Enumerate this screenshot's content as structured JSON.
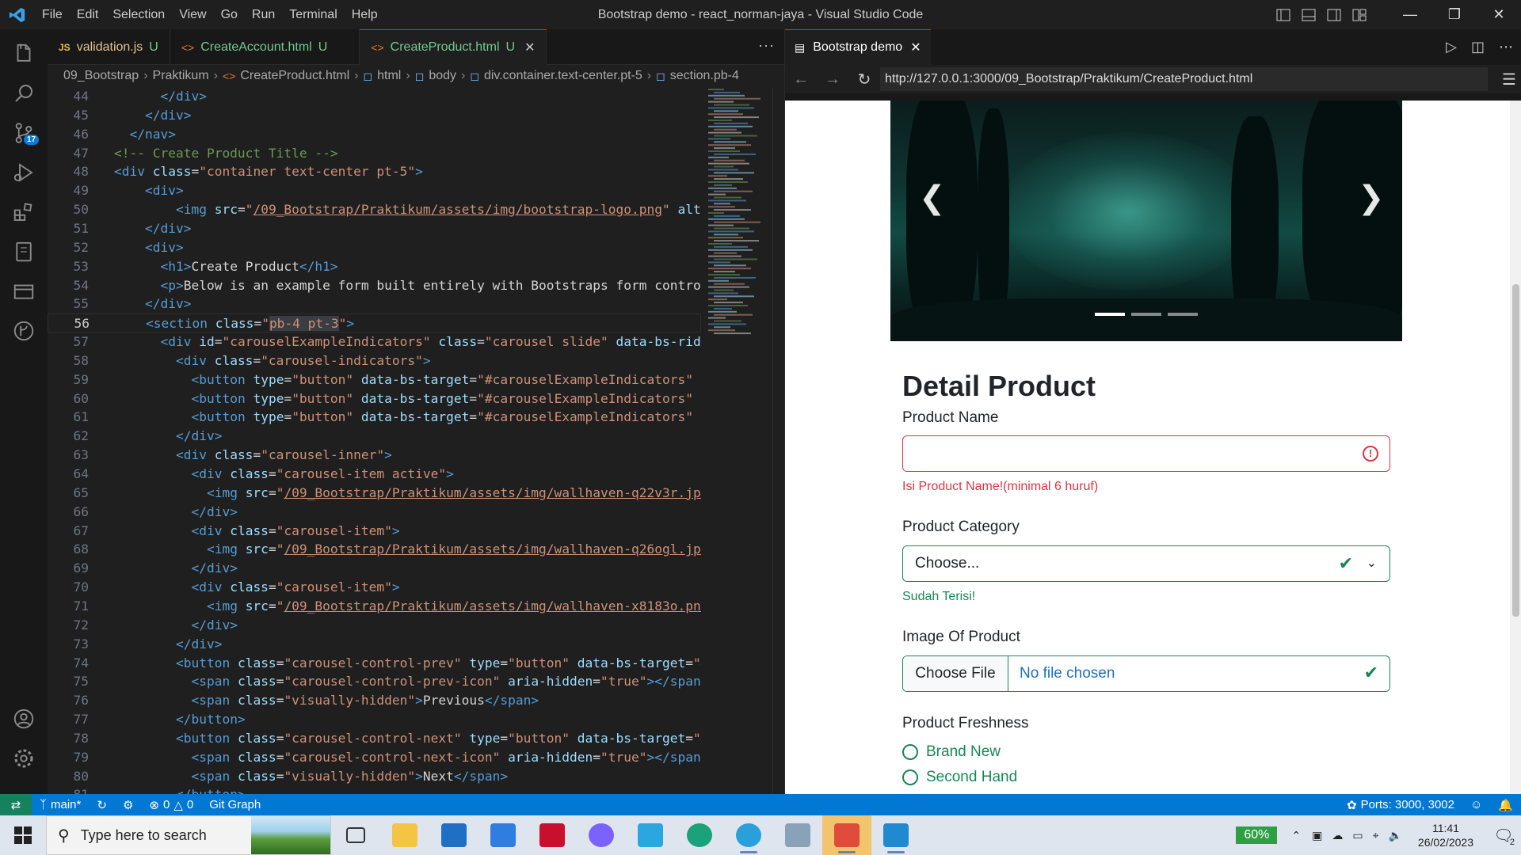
{
  "titlebar": {
    "menu": [
      "File",
      "Edit",
      "Selection",
      "View",
      "Go",
      "Run",
      "Terminal",
      "Help"
    ],
    "title": "Bootstrap demo - react_norman-jaya - Visual Studio Code"
  },
  "activity": {
    "source_control_badge": "17"
  },
  "editor": {
    "tabs": [
      {
        "icon": "JS",
        "label": "validation.js",
        "status": "U"
      },
      {
        "icon": "<>",
        "label": "CreateAccount.html",
        "status": "U"
      },
      {
        "icon": "<>",
        "label": "CreateProduct.html",
        "status": "U",
        "active": true
      }
    ],
    "more": "···",
    "breadcrumb": [
      "09_Bootstrap",
      "Praktikum",
      "CreateProduct.html",
      "html",
      "body",
      "div.container.text-center.pt-5",
      "section.pb-4"
    ]
  },
  "code": [
    {
      "n": "44",
      "html": "      &lt;/div&gt;"
    },
    {
      "n": "45",
      "html": "    &lt;/div&gt;"
    },
    {
      "n": "46",
      "html": "  &lt;/nav&gt;"
    }
  ],
  "preview": {
    "tab_label": "Bootstrap demo",
    "url": "http://127.0.0.1:3000/09_Bootstrap/Praktikum/CreateProduct.html",
    "page": {
      "heading": "Detail Product",
      "product_name_label": "Product Name",
      "product_name_value": "",
      "product_name_feedback": "Isi Product Name!(minimal 6 huruf)",
      "category_label": "Product Category",
      "category_value": "Choose...",
      "category_feedback": "Sudah Terisi!",
      "image_label": "Image Of Product",
      "choose_file": "Choose File",
      "no_file": "No file chosen",
      "freshness_label": "Product Freshness",
      "freshness_options": [
        "Brand New",
        "Second Hand"
      ],
      "carousel_active_index": 1,
      "carousel_count": 3
    }
  },
  "status": {
    "branch": "main*",
    "problems_errors": "0",
    "problems_warnings": "0",
    "git_graph": "Git Graph",
    "ports": "Ports: 3000, 3002"
  },
  "taskbar": {
    "search_placeholder": "Type here to search",
    "battery": "60%",
    "time": "11:41",
    "date": "26/02/2023",
    "notifications": "2",
    "apps": [
      {
        "name": "task-view",
        "color": "#3c3c3c"
      },
      {
        "name": "file-explorer",
        "color": "#f4c542"
      },
      {
        "name": "mail",
        "color": "#1f6fc5"
      },
      {
        "name": "todo",
        "color": "#2f7de1"
      },
      {
        "name": "mcafee",
        "color": "#c8102e"
      },
      {
        "name": "copilot",
        "color": "#7b61ff"
      },
      {
        "name": "app-l",
        "color": "#2aa7df"
      },
      {
        "name": "edge",
        "color": "#1aa27a"
      },
      {
        "name": "telegram",
        "color": "#2aa0da"
      },
      {
        "name": "photos",
        "color": "#8aa2b8"
      },
      {
        "name": "red-app",
        "color": "#e04b3b"
      },
      {
        "name": "vscode",
        "color": "#1f8ad2"
      }
    ]
  }
}
